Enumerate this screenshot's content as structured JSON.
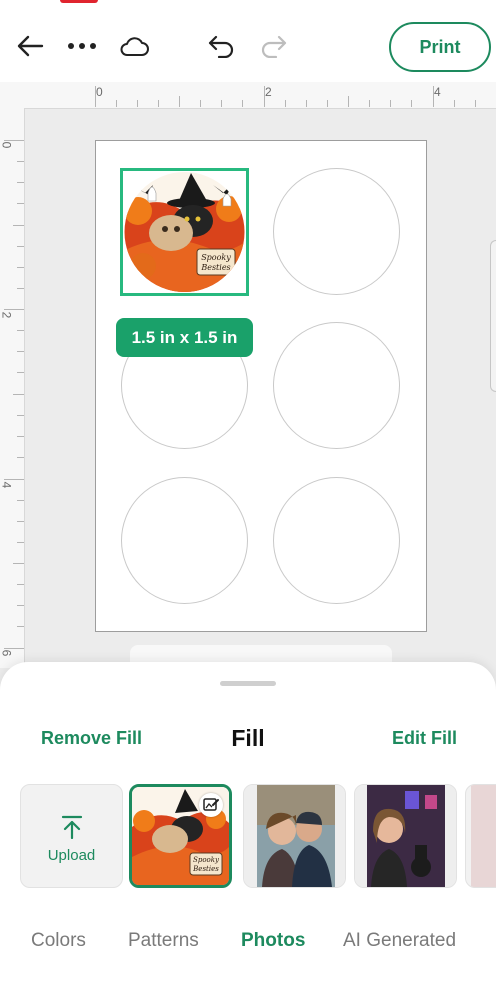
{
  "toolbar": {
    "print_label": "Print",
    "icons": [
      "back-arrow-icon",
      "more-dots-icon",
      "cloud-icon",
      "undo-icon",
      "redo-icon"
    ]
  },
  "ruler": {
    "top_labels": [
      "0",
      "2",
      "4"
    ],
    "left_labels": [
      "0",
      "2",
      "4",
      "6"
    ]
  },
  "canvas": {
    "selection_size": "1.5 in x 1.5 in",
    "sticker_text": "Spooky Besties",
    "empty_slots": 5
  },
  "fill_panel": {
    "remove_fill_label": "Remove Fill",
    "title": "Fill",
    "edit_fill_label": "Edit Fill",
    "upload_label": "Upload",
    "tabs": [
      {
        "label": "Colors",
        "active": false
      },
      {
        "label": "Patterns",
        "active": false
      },
      {
        "label": "Photos",
        "active": true
      },
      {
        "label": "AI Generated",
        "active": false
      }
    ]
  },
  "colors": {
    "accent": "#1d8a5e",
    "selection": "#27b97f",
    "badge": "#1aa16a"
  }
}
